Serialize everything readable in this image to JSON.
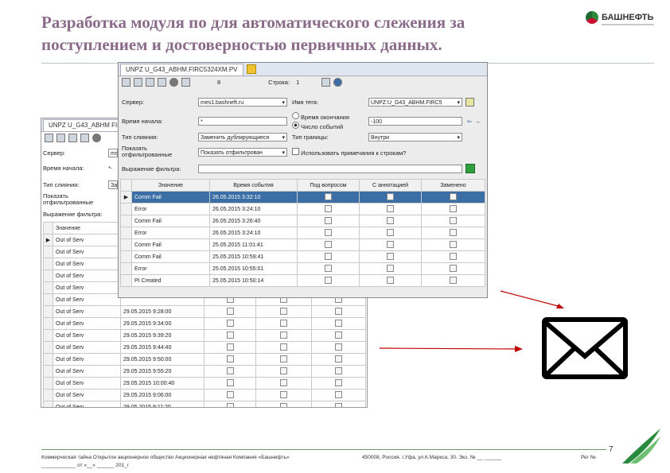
{
  "slide": {
    "title": "Разработка модуля по для автоматического слежения за поступлением и достоверностью первичных данных.",
    "logo_text": "БАШНЕФТЬ",
    "page_number": "7",
    "footer_left": "Коммерческая тайна Открытое акционерное общество Акционерная нефтяная Компания «Башнефть»",
    "footer_left_line2": "____________ от «__» ______ 201_г",
    "footer_mid": "450008, Россия, г.Уфа, ул.К.Маркса, 30. Экз. № __ ______",
    "footer_right": "Рег №"
  },
  "back_window": {
    "tab": "UNPZ U_G43_ABHM FIRC5",
    "labels": {
      "server": "Сервер:",
      "start_time": "Время начала:",
      "merge_type": "Тип слияния:",
      "show_filtered": "Показать отфильтрованные",
      "filter_expr": "Выражение фильтра:",
      "col_value": "Значение"
    },
    "server_value": "ms",
    "start_value": "*-",
    "merge_value": "За",
    "rows": [
      {
        "value": "Out of Serv",
        "time": ""
      },
      {
        "value": "Out of Serv",
        "time": ""
      },
      {
        "value": "Out of Serv",
        "time": ""
      },
      {
        "value": "Out of Serv",
        "time": ""
      },
      {
        "value": "Out of Serv",
        "time": ""
      },
      {
        "value": "Out of Serv",
        "time": ""
      },
      {
        "value": "Out of Serv",
        "time": "29.05.2015 9:28:00"
      },
      {
        "value": "Out of Serv",
        "time": "29.05.2015 9:34:00"
      },
      {
        "value": "Out of Serv",
        "time": "29.05.2015 9:39:20"
      },
      {
        "value": "Out of Serv",
        "time": "29.05.2015 9:44:40"
      },
      {
        "value": "Out of Serv",
        "time": "29.05.2015 9:50:00"
      },
      {
        "value": "Out of Serv",
        "time": "29.05.2015 9:55:20"
      },
      {
        "value": "Out of Serv",
        "time": "29.05.2015 10:00:40"
      },
      {
        "value": "Out of Serv",
        "time": "29.05.2015 9:06:00"
      },
      {
        "value": "Out of Serv",
        "time": "29.05.2015 9:11:20"
      }
    ]
  },
  "front_window": {
    "tab": "UNPZ U_G43_ABHM.FIRC5324XM.PV",
    "toolbar_number": "8",
    "row_label": "Строка:",
    "row_value": "1",
    "labels": {
      "server": "Сервер:",
      "start_time": "Время начала:",
      "merge_type": "Тип слияния:",
      "show_filtered": "Показать отфильтрованные",
      "filter_expr": "Выражение фильтра:",
      "tag_name": "Имя тега:",
      "end_time": "Время окончания",
      "event_count": "Число событий",
      "boundary_type": "Тип границы:",
      "use_notes": "Использовать примечания к строкам?"
    },
    "server_value": "mes1.bashneft.ru",
    "start_value": "*",
    "merge_value": "Заменить дублирующиеся",
    "show_filtered_value": "Показать отфильтрован",
    "tag_value": "UNPZ:U_G43_ABHM.FIRC5",
    "count_value": "-100",
    "boundary_value": "Внутри",
    "columns": [
      "Значение",
      "Время события",
      "Под вопросом",
      "С аннотацией",
      "Заменено"
    ],
    "rows": [
      {
        "value": "Comm Fail",
        "time": "26.05.2015 3:32:10"
      },
      {
        "value": "Error",
        "time": "26.05.2015 3:24:10"
      },
      {
        "value": "Comm Fail",
        "time": "26.05.2015 3:26:40"
      },
      {
        "value": "Error",
        "time": "26.05.2015 3:24:10"
      },
      {
        "value": "Comm Fail",
        "time": "25.05.2015 11:01:41"
      },
      {
        "value": "Comm Fail",
        "time": "25.05.2015 10:59:41"
      },
      {
        "value": "Error",
        "time": "25.05.2015 10:55:01"
      },
      {
        "value": "PI Created",
        "time": "25.05.2015 10:50:14"
      }
    ]
  }
}
